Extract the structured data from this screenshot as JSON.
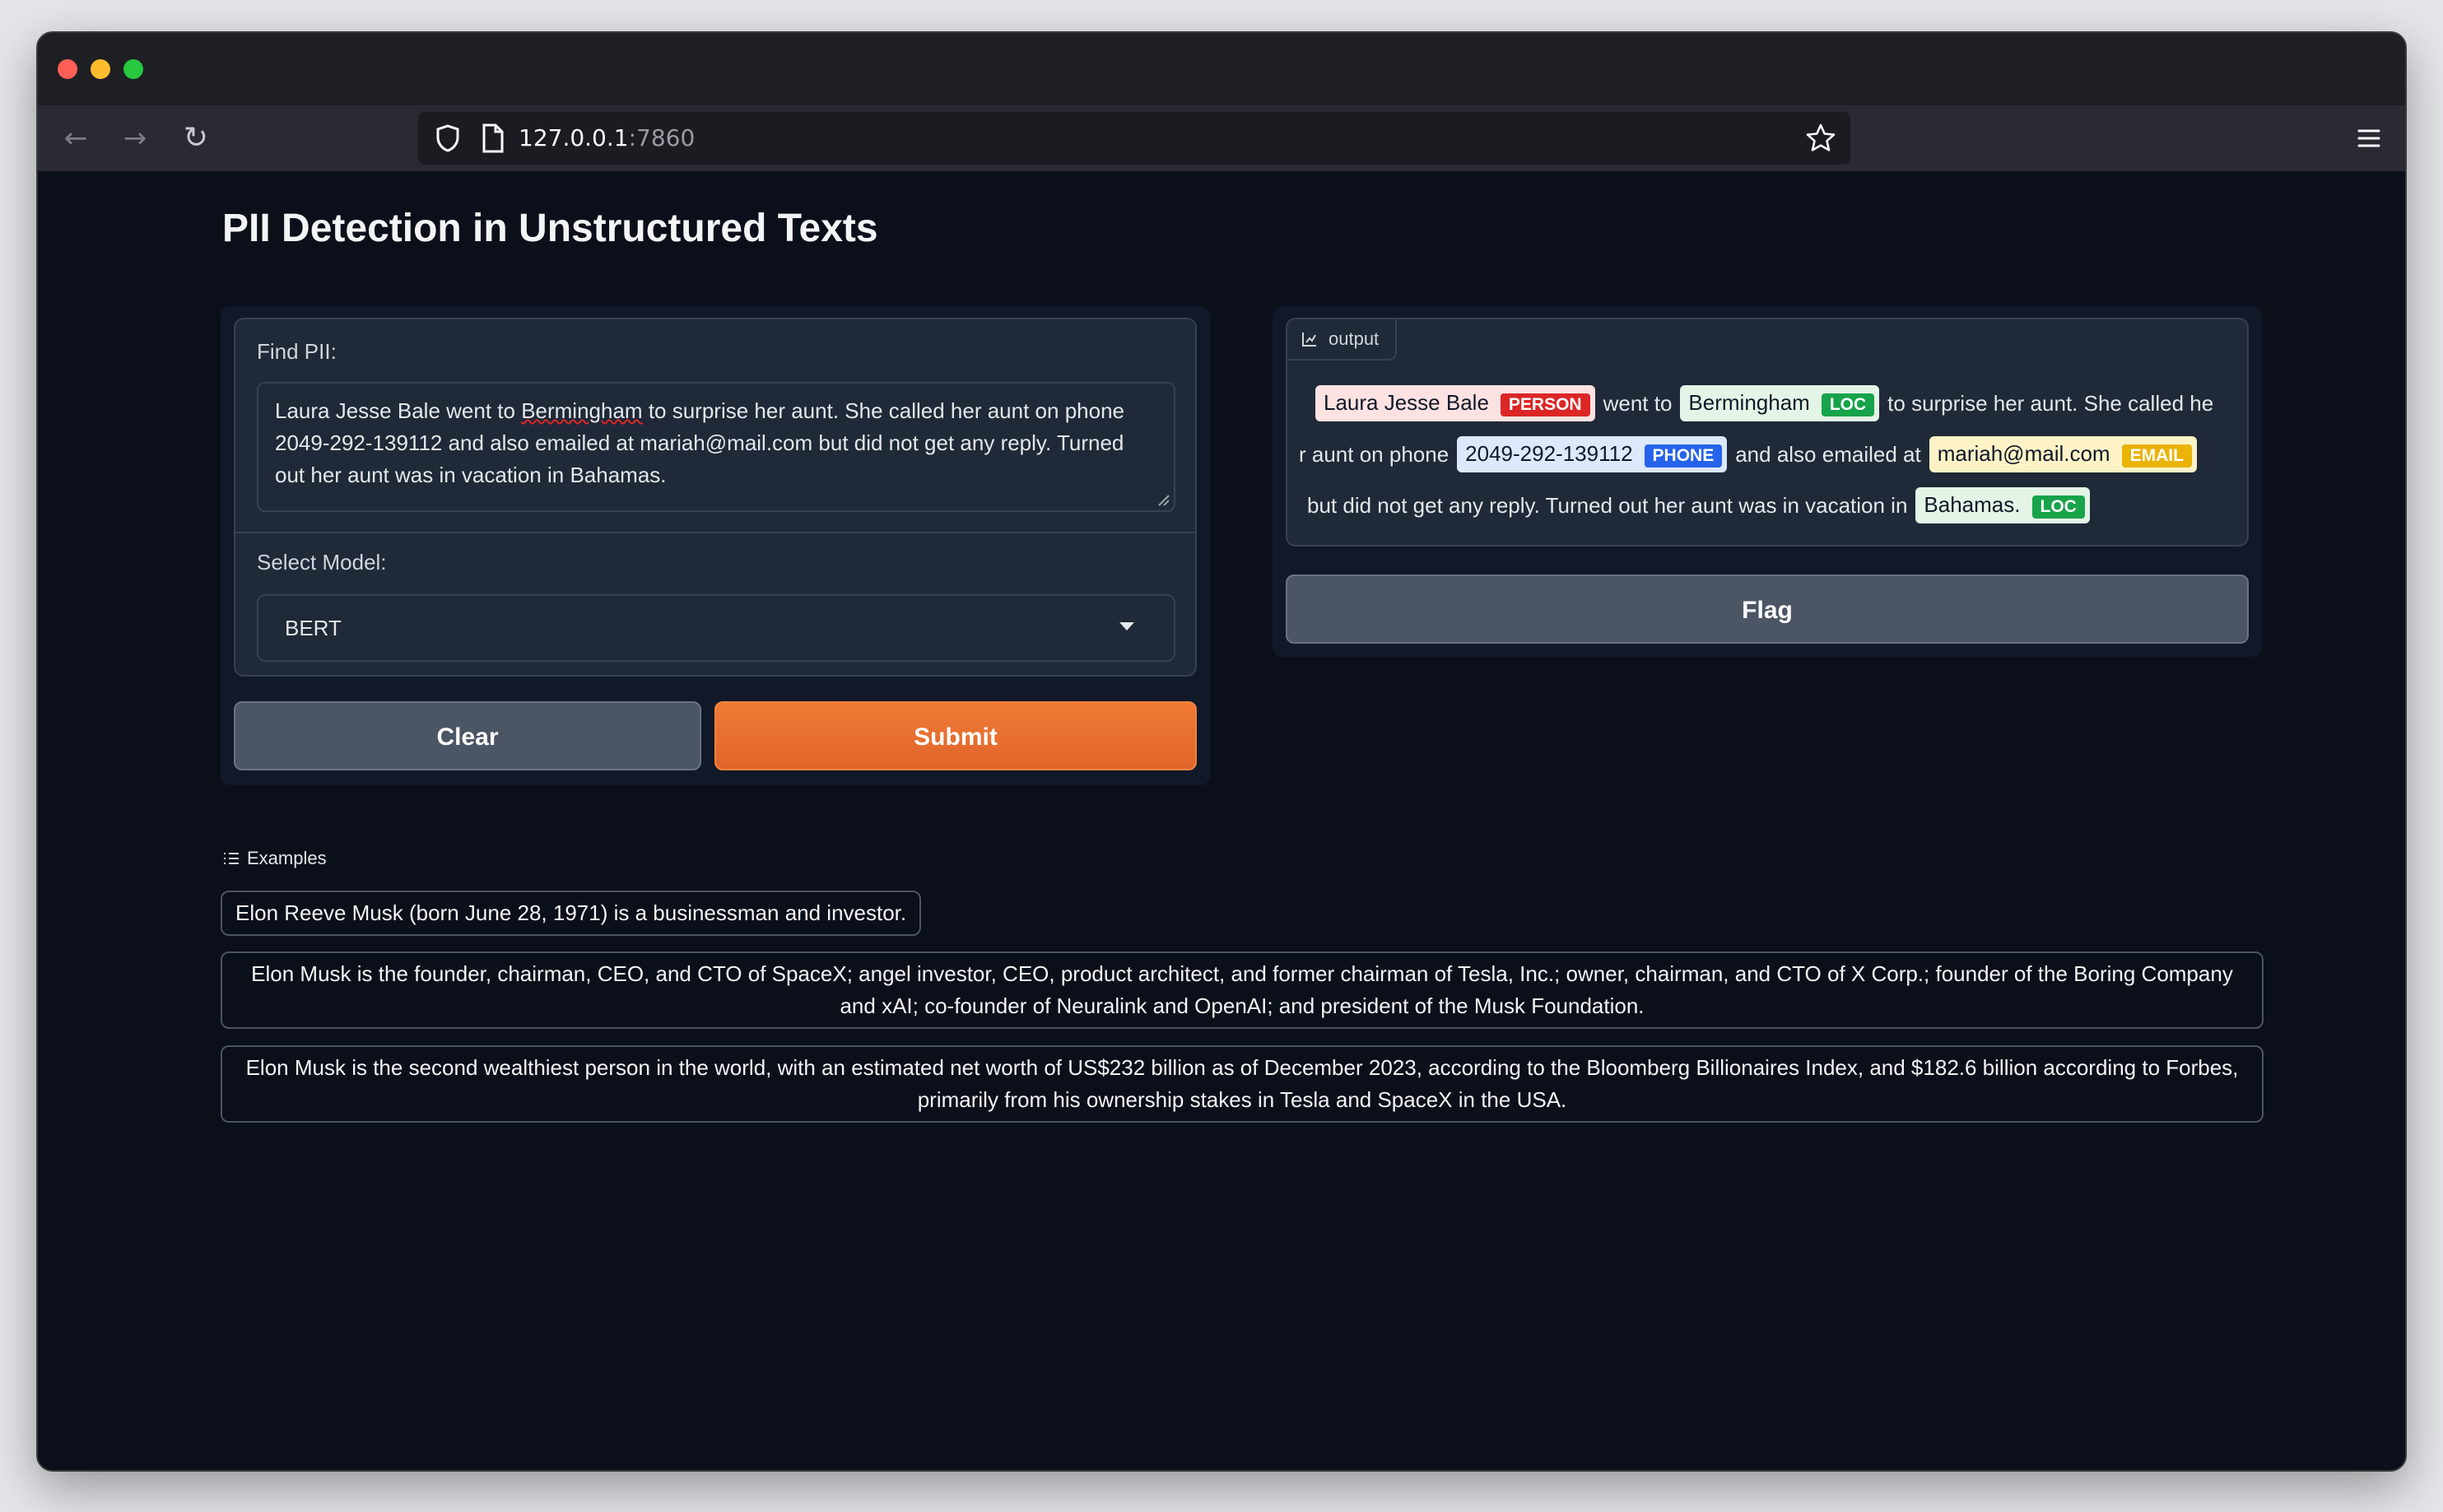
{
  "browser": {
    "url_host": "127.0.0.1",
    "url_port": ":7860"
  },
  "page": {
    "title": "PII Detection in Unstructured Texts"
  },
  "input": {
    "find_label": "Find PII:",
    "text_part1": "Laura Jesse Bale went to ",
    "text_misspelled": "Bermingham",
    "text_part2": " to surprise her aunt. She called her aunt on phone 2049-292-139112 and also emailed at mariah@mail.com but did not get any reply. Turned out her aunt was in vacation in Bahamas.",
    "model_label": "Select Model:",
    "model_value": "BERT"
  },
  "buttons": {
    "clear": "Clear",
    "submit": "Submit",
    "flag": "Flag"
  },
  "output": {
    "tab_label": "output",
    "line1": {
      "e1_text": "Laura Jesse Bale",
      "e1_tag": "PERSON",
      "t1": "went to",
      "e2_text": "Bermingham",
      "e2_tag": "LOC",
      "t2": "to surprise her aunt. She called he"
    },
    "line2": {
      "t1": "r aunt on phone",
      "e1_text": "2049-292-139112",
      "e1_tag": "PHONE",
      "t2": "and also emailed at",
      "e2_text": "mariah@mail.com",
      "e2_tag": "EMAIL"
    },
    "line3": {
      "t1": "but did not get any reply. Turned out her aunt was in vacation in",
      "e1_text": "Bahamas.",
      "e1_tag": "LOC"
    }
  },
  "examples": {
    "label": "Examples",
    "items": [
      "Elon Reeve Musk (born June 28, 1971) is a businessman and investor.",
      "Elon Musk is the founder, chairman, CEO, and CTO of SpaceX; angel investor, CEO, product architect, and former chairman of Tesla, Inc.; owner, chairman, and CTO of X Corp.; founder of the Boring Company and xAI; co-founder of Neuralink and OpenAI; and president of the Musk Foundation.",
      "Elon Musk is the second wealthiest person in the world, with an estimated net worth of US$232 billion as of December 2023, according to the Bloomberg Billionaires Index, and $182.6 billion according to Forbes, primarily from his ownership stakes in Tesla and SpaceX in the USA."
    ]
  },
  "colors": {
    "submit": "#e8702f",
    "background": "#0b0f19",
    "person": "#dc2626",
    "loc": "#16a34a",
    "phone": "#2563eb",
    "email": "#eab308"
  }
}
